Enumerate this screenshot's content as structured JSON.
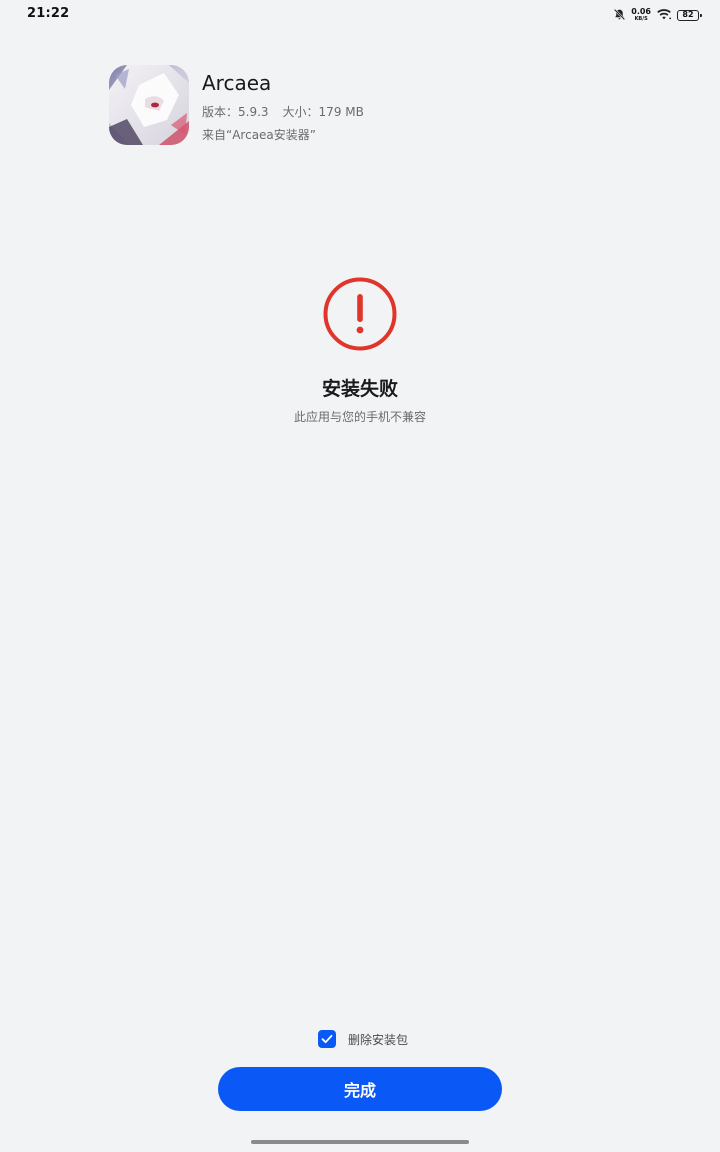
{
  "status_bar": {
    "time": "21:22",
    "net_speed_value": "0.06",
    "net_speed_unit": "KB/S",
    "battery_level": "82",
    "icons": [
      "mute-icon",
      "wifi-icon",
      "battery-icon"
    ]
  },
  "app": {
    "name": "Arcaea",
    "version": "版本：5.9.3",
    "size": "大小：179 MB",
    "source": "来自“Arcaea安装器”"
  },
  "result": {
    "icon": "error-exclamation-icon",
    "title": "安装失败",
    "subtitle": "此应用与您的手机不兼容"
  },
  "footer": {
    "delete_package_label": "删除安装包",
    "delete_package_checked": true,
    "done_label": "完成"
  },
  "colors": {
    "accent": "#0a59f7",
    "error": "#e0352b",
    "background": "#f2f3f5"
  }
}
